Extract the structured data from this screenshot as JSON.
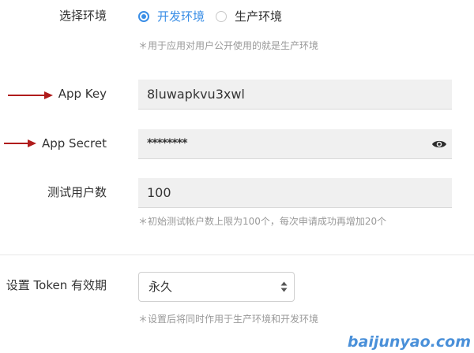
{
  "environment": {
    "label": "选择环境",
    "options": [
      {
        "label": "开发环境",
        "selected": true
      },
      {
        "label": "生产环境",
        "selected": false
      }
    ],
    "hint": "＊用于应用对用户公开使用的就是生产环境"
  },
  "app_key": {
    "label": "App Key",
    "value": "8luwapkvu3xwl"
  },
  "app_secret": {
    "label": "App Secret",
    "value": "********",
    "toggle_icon": "eye-icon"
  },
  "test_users": {
    "label": "测试用户数",
    "value": "100",
    "hint": "＊初始测试帐户数上限为100个，每次申请成功再增加20个"
  },
  "token": {
    "label": "设置 Token 有效期",
    "selected": "永久",
    "hint": "＊设置后将同时作用于生产环境和开发环境"
  },
  "watermark": "baijunyao.com",
  "colors": {
    "accent": "#3a8ee6",
    "arrow": "#b01c1c",
    "field_bg": "#f0f0f0",
    "hint": "#999999",
    "watermark": "#4a90d9"
  }
}
